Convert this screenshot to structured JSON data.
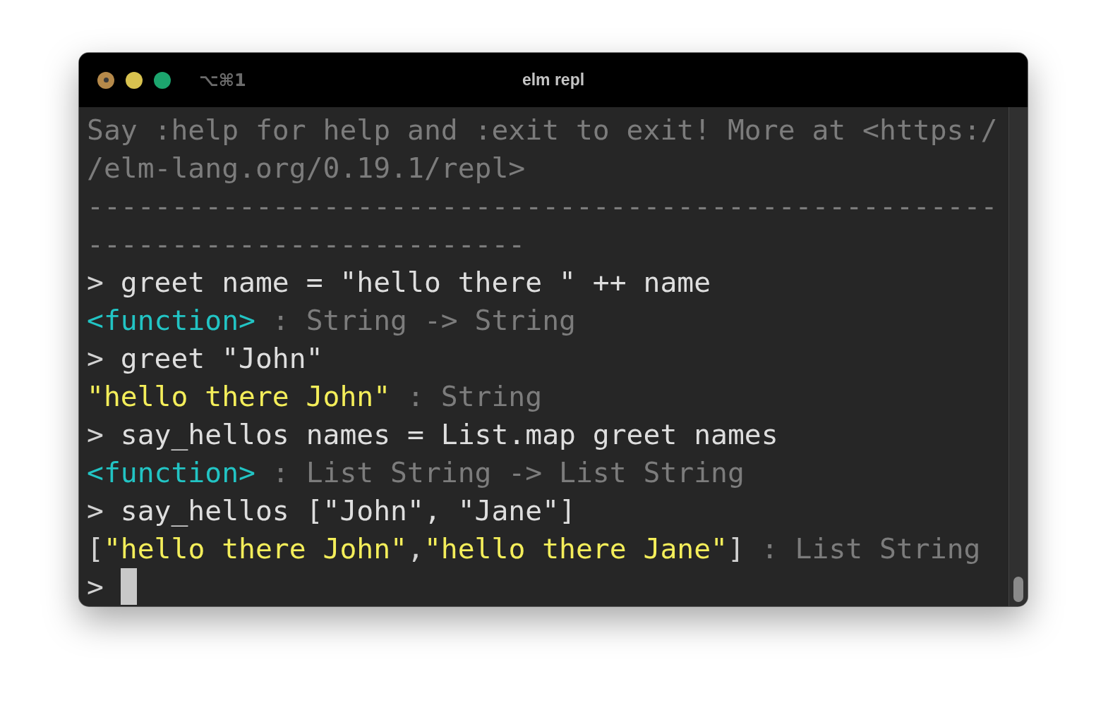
{
  "window": {
    "title": "elm repl",
    "shortcut": "⌥⌘1"
  },
  "lines": [
    {
      "segments": [
        {
          "kind": "dim",
          "text": "Say :help for help and :exit to exit! More at <https:/"
        }
      ]
    },
    {
      "segments": [
        {
          "kind": "dim",
          "text": "/elm-lang.org/0.19.1/repl>"
        }
      ]
    },
    {
      "segments": [
        {
          "kind": "dim",
          "text": "------------------------------------------------------"
        }
      ]
    },
    {
      "segments": [
        {
          "kind": "dim",
          "text": "--------------------------"
        }
      ]
    },
    {
      "segments": [
        {
          "kind": "prompt",
          "text": ">"
        },
        {
          "kind": "input",
          "text": "greet name = \"hello there \" ++ name"
        }
      ]
    },
    {
      "segments": [
        {
          "kind": "function",
          "text": "<function>"
        },
        {
          "kind": "dim",
          "text": " : String -> String"
        }
      ]
    },
    {
      "segments": [
        {
          "kind": "prompt",
          "text": ">"
        },
        {
          "kind": "input",
          "text": "greet \"John\""
        }
      ]
    },
    {
      "segments": [
        {
          "kind": "string",
          "text": "\"hello there John\""
        },
        {
          "kind": "dim",
          "text": " : String"
        }
      ]
    },
    {
      "segments": [
        {
          "kind": "prompt",
          "text": ">"
        },
        {
          "kind": "input",
          "text": "say_hellos names = List.map greet names"
        }
      ]
    },
    {
      "segments": [
        {
          "kind": "function",
          "text": "<function>"
        },
        {
          "kind": "dim",
          "text": " : List String -> List String"
        }
      ]
    },
    {
      "segments": [
        {
          "kind": "prompt",
          "text": ">"
        },
        {
          "kind": "input",
          "text": "say_hellos [\"John\", \"Jane\"]"
        }
      ]
    },
    {
      "segments": [
        {
          "kind": "plain",
          "text": "["
        },
        {
          "kind": "string",
          "text": "\"hello there John\""
        },
        {
          "kind": "plain",
          "text": ","
        },
        {
          "kind": "string",
          "text": "\"hello there Jane\""
        },
        {
          "kind": "plain",
          "text": "]"
        },
        {
          "kind": "dim",
          "text": " : List String"
        }
      ]
    },
    {
      "segments": [
        {
          "kind": "prompt",
          "text": ">"
        }
      ],
      "cursor": true
    }
  ]
}
